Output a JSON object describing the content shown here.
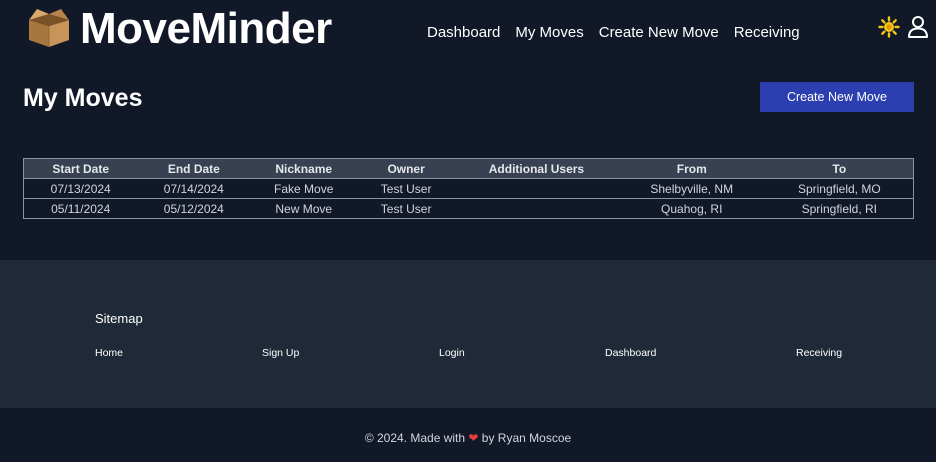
{
  "brand": {
    "name": "MoveMinder",
    "logo_icon": "cardboard-box-icon"
  },
  "nav": {
    "links": [
      "Dashboard",
      "My Moves",
      "Create New Move",
      "Receiving"
    ],
    "theme_icon": "sun-icon",
    "user_icon": "user-icon"
  },
  "page": {
    "title": "My Moves",
    "create_button": "Create New Move"
  },
  "table": {
    "headers": [
      "Start  Date",
      "End  Date",
      "Nickname",
      "Owner",
      "Additional Users",
      "From",
      "To"
    ],
    "rows": [
      [
        "07/13/2024",
        "07/14/2024",
        "Fake Move",
        "Test User",
        "",
        "Shelbyville, NM",
        "Springfield, MO"
      ],
      [
        "05/11/2024",
        "05/12/2024",
        "New Move",
        "Test User",
        "",
        "Quahog, RI",
        "Springfield, RI"
      ]
    ]
  },
  "footer": {
    "sitemap_title": "Sitemap",
    "links": [
      "Home",
      "Sign Up",
      "Login",
      "Dashboard",
      "Receiving"
    ],
    "copyright_prefix": "© 2024. Made with",
    "copyright_suffix": "by Ryan Moscoe",
    "heart_icon": "heart-icon"
  },
  "colors": {
    "background": "#111827",
    "footer_background": "#1f2937",
    "button": "#2b3fb0",
    "table_header": "#374151"
  }
}
